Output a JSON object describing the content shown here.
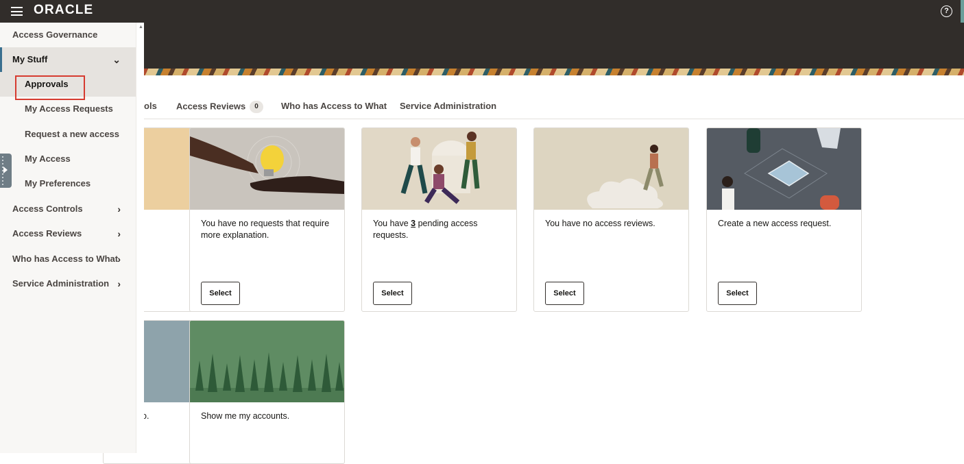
{
  "brand": {
    "logo": "ORACLE"
  },
  "tabs": [
    {
      "label": "rols"
    },
    {
      "label": "Access Reviews",
      "badge": "0"
    },
    {
      "label": "Who has Access to What"
    },
    {
      "label": "Service Administration"
    }
  ],
  "sidebar": {
    "items": [
      {
        "label": "Access Governance"
      },
      {
        "label": "My Stuff"
      },
      {
        "label": "Approvals"
      },
      {
        "label": "My Access Requests"
      },
      {
        "label": "Request a new access"
      },
      {
        "label": "My Access"
      },
      {
        "label": "My Preferences"
      },
      {
        "label": "Access Controls"
      },
      {
        "label": "Access Reviews"
      },
      {
        "label": "Who has Access to What"
      },
      {
        "label": "Service Administration"
      }
    ]
  },
  "cards": [
    {
      "text": "You have no requests that require more explanation.",
      "button": "Select"
    },
    {
      "text_before": "You have ",
      "count": "3",
      "text_after": " pending access requests.",
      "button": "Select"
    },
    {
      "text": "You have no access reviews.",
      "button": "Select"
    },
    {
      "text": "Create a new access request.",
      "button": "Select"
    },
    {
      "text": "Show me my accounts."
    }
  ],
  "partial_card_text": "o.",
  "icons": [
    "hamburger-icon",
    "help-icon",
    "chevron-down-icon",
    "chevron-right-icon",
    "panel-toggle-icon"
  ]
}
